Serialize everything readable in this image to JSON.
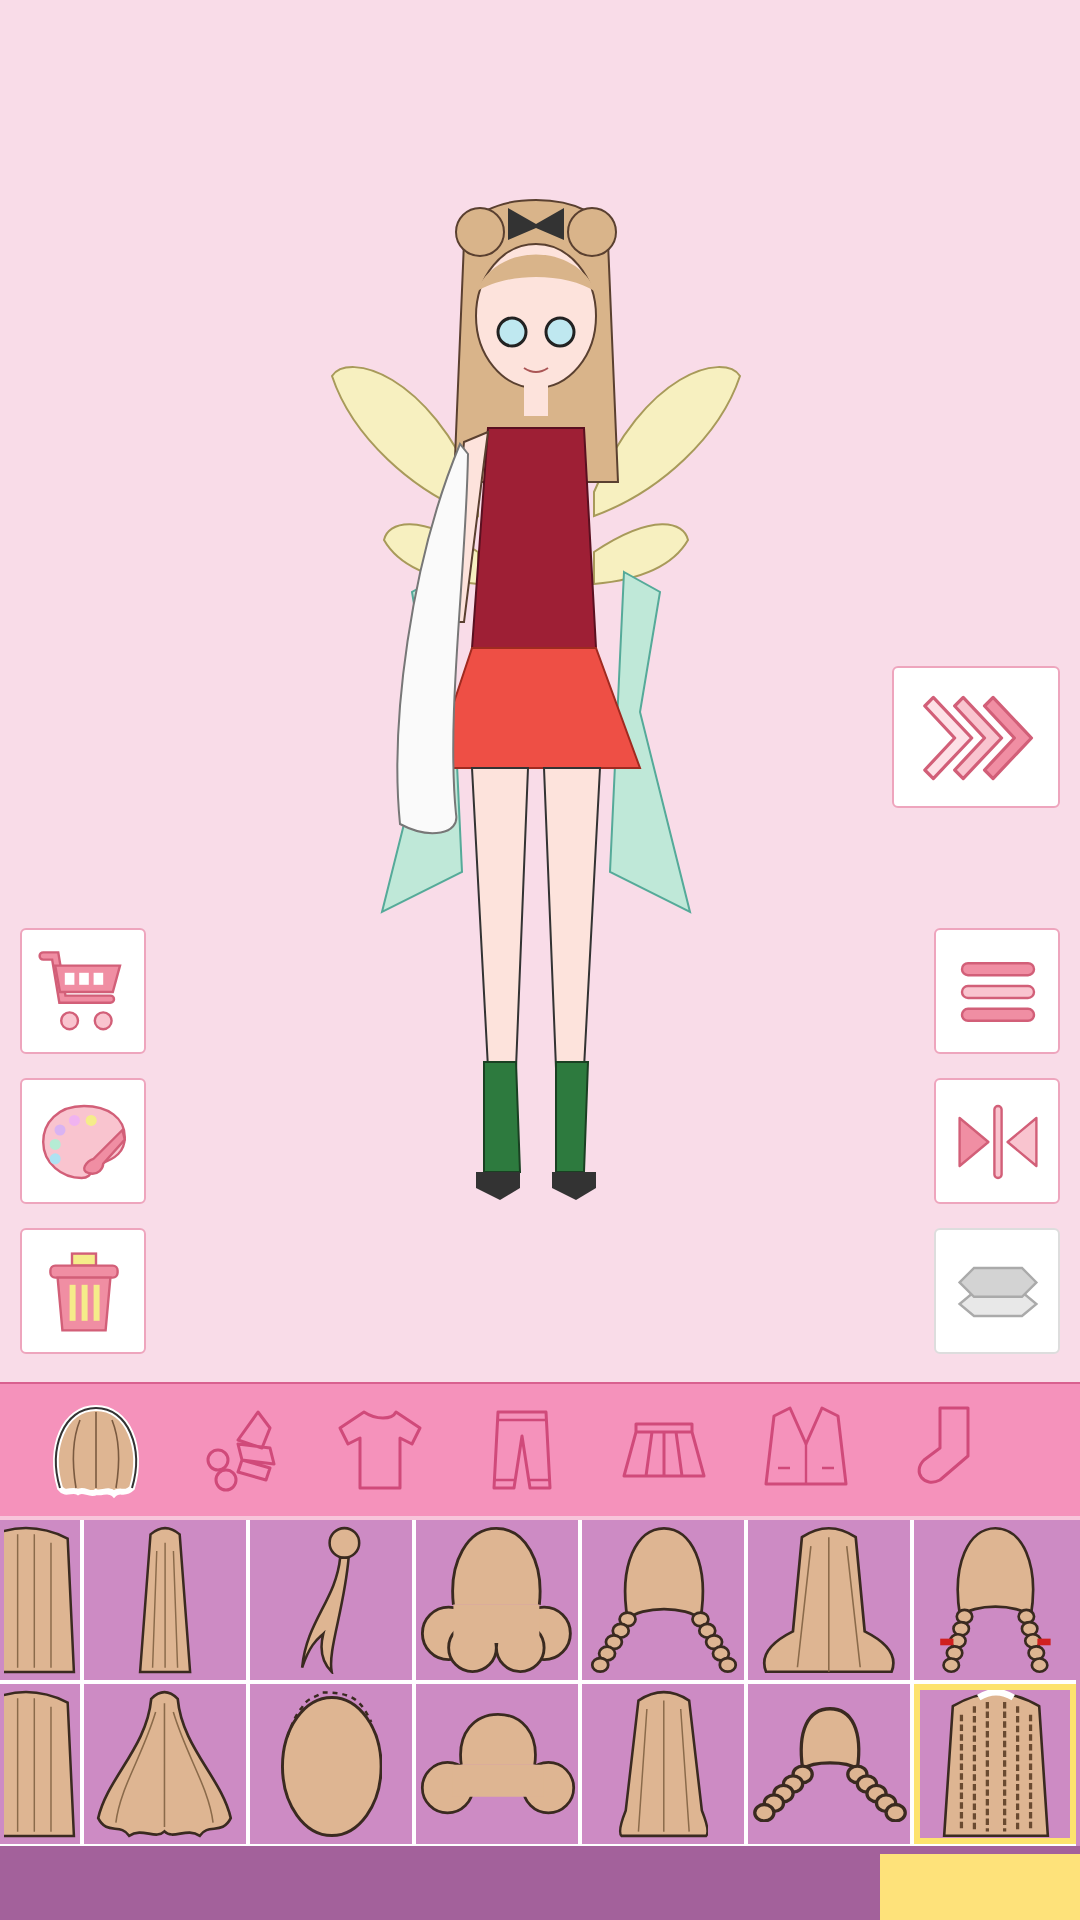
{
  "toolbar_left": [
    {
      "kind": "cart",
      "disabled": false
    },
    {
      "kind": "palette",
      "disabled": false
    },
    {
      "kind": "trash",
      "disabled": false
    }
  ],
  "toolbar_right": [
    {
      "kind": "next",
      "disabled": false
    },
    {
      "kind": "menu",
      "disabled": false
    },
    {
      "kind": "mirror",
      "disabled": false
    },
    {
      "kind": "layers",
      "disabled": true
    }
  ],
  "category_tabs": [
    {
      "kind": "hair",
      "selected": true
    },
    {
      "kind": "bow",
      "selected": false
    },
    {
      "kind": "shirt",
      "selected": false
    },
    {
      "kind": "pants",
      "selected": false
    },
    {
      "kind": "skirt",
      "selected": false
    },
    {
      "kind": "jacket",
      "selected": false
    },
    {
      "kind": "sock",
      "selected": false
    }
  ],
  "hair_items": [
    {
      "kind": "long-straight",
      "selected": false
    },
    {
      "kind": "long-ponytail",
      "selected": false
    },
    {
      "kind": "side-ponytail",
      "selected": false
    },
    {
      "kind": "curly-bob",
      "selected": false
    },
    {
      "kind": "braids",
      "selected": false
    },
    {
      "kind": "flared",
      "selected": false
    },
    {
      "kind": "braids-ribbon",
      "selected": false
    },
    {
      "kind": "long-straight",
      "selected": false
    },
    {
      "kind": "wavy",
      "selected": false
    },
    {
      "kind": "afro",
      "selected": false
    },
    {
      "kind": "buns",
      "selected": false
    },
    {
      "kind": "straight",
      "selected": false
    },
    {
      "kind": "short-braids",
      "selected": false
    },
    {
      "kind": "dreadlocks",
      "selected": true
    }
  ]
}
